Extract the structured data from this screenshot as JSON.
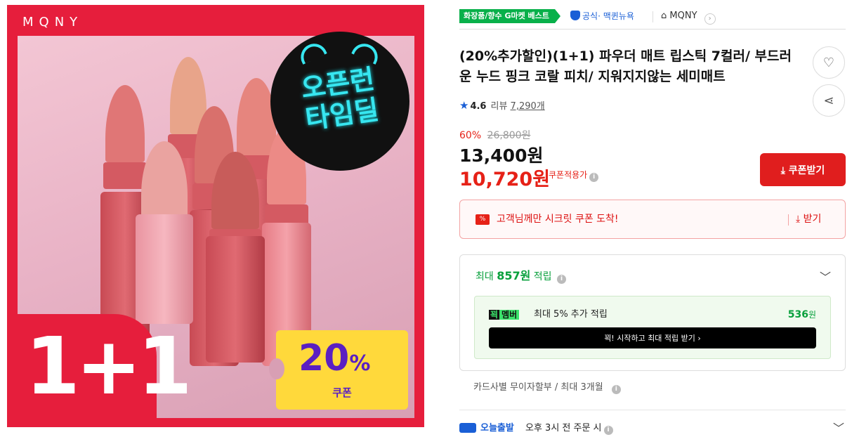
{
  "hero": {
    "brand": "MQNY",
    "badge_line1": "오픈런",
    "badge_line2": "타임딜",
    "bundle": "1+1",
    "coupon_pct": "20",
    "coupon_pct_sign": "%",
    "coupon_label": "쿠폰"
  },
  "topbar": {
    "best_badge": "화장품/향수 G마켓 베스트",
    "official": "공식",
    "official_sub": "· 맥퀸뉴욕",
    "store_name": "MQNY",
    "store_chevron": "›"
  },
  "product": {
    "title": "(20%추가할인)(1+1) 파우더 매트 립스틱 7컬러/ 부드러운 누드 핑크 코랄 피치/ 지워지지않는 세미매트",
    "rating": "4.6",
    "review_label": "리뷰",
    "review_count": "7,290개",
    "star": "★",
    "wish_icon": "♡",
    "share_icon": "⋖"
  },
  "pricing": {
    "discount_pct": "60%",
    "original_price": "26,800원",
    "price": "13,400원",
    "coupon_price": "10,720원",
    "coupon_note": "쿠폰적용가",
    "info_glyph": "i",
    "coupon_button": "⤓ 쿠폰받기"
  },
  "secret_coupon": {
    "ticket_glyph": "%",
    "message": "고객님께만 시크릿 쿠폰 도착!",
    "receive": "⤓ 받기"
  },
  "points": {
    "prefix": "최대",
    "amount": "857원",
    "suffix": "적립",
    "chevron": "﹀",
    "member_logo_a": "꾁",
    "member_logo_b": "멤버",
    "member_desc": "최대 5% 추가 적립",
    "member_amount": "536",
    "member_amount_unit": "원",
    "member_cta": "꾁! 시작하고 최대 적립 받기  ›"
  },
  "installment": {
    "text": "카드사별 무이자할부 / 최대 3개월"
  },
  "shipping": {
    "label": "오늘출발",
    "text": "오후 3시 전 주문 시",
    "chevron": "﹀"
  },
  "colors": {
    "brand_red": "#e61e3c",
    "price_red": "#e62117",
    "gmarket_green": "#08b04a",
    "link_blue": "#1a5fd6",
    "badge_cyan": "#37e6f0",
    "coupon_yellow": "#ffd93b",
    "coupon_purple": "#5a1fc2"
  }
}
